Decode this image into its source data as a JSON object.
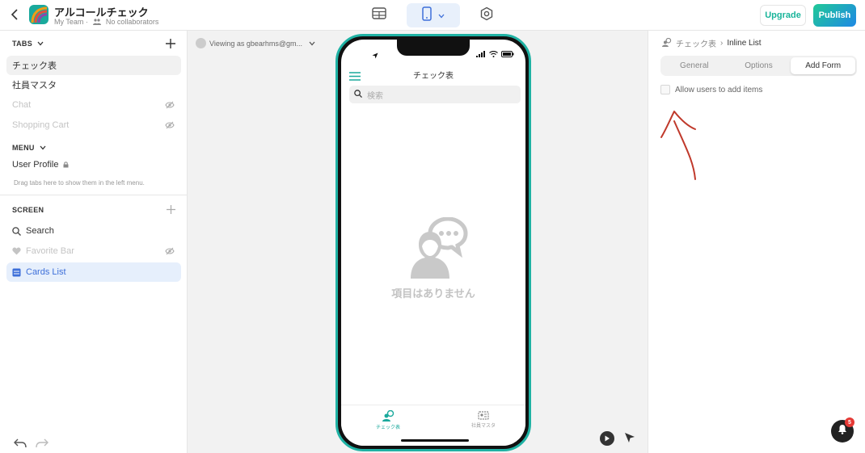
{
  "header": {
    "app_title": "アルコールチェック",
    "team": "My Team",
    "sep": "·",
    "collaborators": "No collaborators",
    "upgrade_label": "Upgrade",
    "publish_label": "Publish"
  },
  "left": {
    "tabs_heading": "TABS",
    "tabs": [
      {
        "label": "チェック表"
      },
      {
        "label": "社員マスタ"
      },
      {
        "label": "Chat"
      },
      {
        "label": "Shopping Cart"
      }
    ],
    "menu_heading": "MENU",
    "menu_items": [
      {
        "label": "User Profile"
      }
    ],
    "menu_hint": "Drag tabs here to show them in the left menu.",
    "screen_heading": "SCREEN",
    "screen_items": [
      {
        "label": "Search"
      },
      {
        "label": "Favorite Bar"
      },
      {
        "label": "Cards List"
      }
    ]
  },
  "canvas": {
    "viewing_as": "Viewing as gbearhms@gm..."
  },
  "phone": {
    "title": "チェック表",
    "search_placeholder": "検索",
    "empty_text": "項目はありません",
    "tabbar": [
      {
        "label": "チェック表"
      },
      {
        "label": "社員マスタ"
      }
    ]
  },
  "right": {
    "breadcrumb_parent": "チェック表",
    "breadcrumb_sep": "›",
    "breadcrumb_current": "Inline List",
    "tabs": [
      {
        "label": "General"
      },
      {
        "label": "Options"
      },
      {
        "label": "Add Form"
      }
    ],
    "active_tab": "Add Form",
    "allow_add_label": "Allow users to add items",
    "allow_add_checked": false,
    "notification_count": "5"
  },
  "colors": {
    "accent": "#1aa99c",
    "selected_blue": "#3d6fd9",
    "annotation_red": "#c0392b"
  }
}
